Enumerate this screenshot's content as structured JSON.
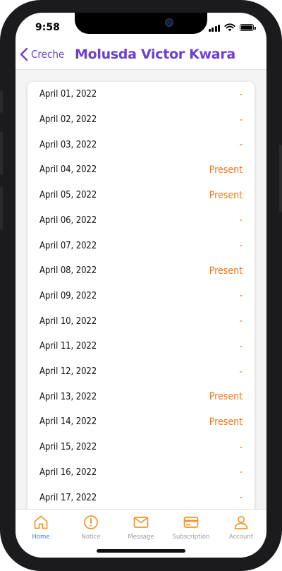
{
  "status_bar": {
    "time": "9:58"
  },
  "navbar": {
    "back_label": "Creche",
    "title": "Molusda Victor Kwara"
  },
  "attendance": [
    {
      "date": "April 01, 2022",
      "status": "-"
    },
    {
      "date": "April 02, 2022",
      "status": "-"
    },
    {
      "date": "April 03, 2022",
      "status": "-"
    },
    {
      "date": "April 04, 2022",
      "status": "Present"
    },
    {
      "date": "April 05, 2022",
      "status": "Present"
    },
    {
      "date": "April 06, 2022",
      "status": "-"
    },
    {
      "date": "April 07, 2022",
      "status": "-"
    },
    {
      "date": "April 08, 2022",
      "status": "Present"
    },
    {
      "date": "April 09, 2022",
      "status": "-"
    },
    {
      "date": "April 10, 2022",
      "status": "-"
    },
    {
      "date": "April 11, 2022",
      "status": "-"
    },
    {
      "date": "April 12, 2022",
      "status": "-"
    },
    {
      "date": "April 13, 2022",
      "status": "Present"
    },
    {
      "date": "April 14, 2022",
      "status": "Present"
    },
    {
      "date": "April 15, 2022",
      "status": "-"
    },
    {
      "date": "April 16, 2022",
      "status": "-"
    },
    {
      "date": "April 17, 2022",
      "status": "-"
    }
  ],
  "tabbar": {
    "tabs": [
      {
        "label": "Home",
        "icon": "home-icon",
        "active": true
      },
      {
        "label": "Notice",
        "icon": "alert-circle-icon",
        "active": false
      },
      {
        "label": "Message",
        "icon": "envelope-icon",
        "active": false
      },
      {
        "label": "Subscription",
        "icon": "credit-card-icon",
        "active": false
      },
      {
        "label": "Account",
        "icon": "user-icon",
        "active": false
      }
    ]
  },
  "colors": {
    "accent_purple": "#6a41cf",
    "status_orange": "#f07820",
    "tab_orange": "#f0952e",
    "tab_active_blue": "#2f7fe0"
  }
}
